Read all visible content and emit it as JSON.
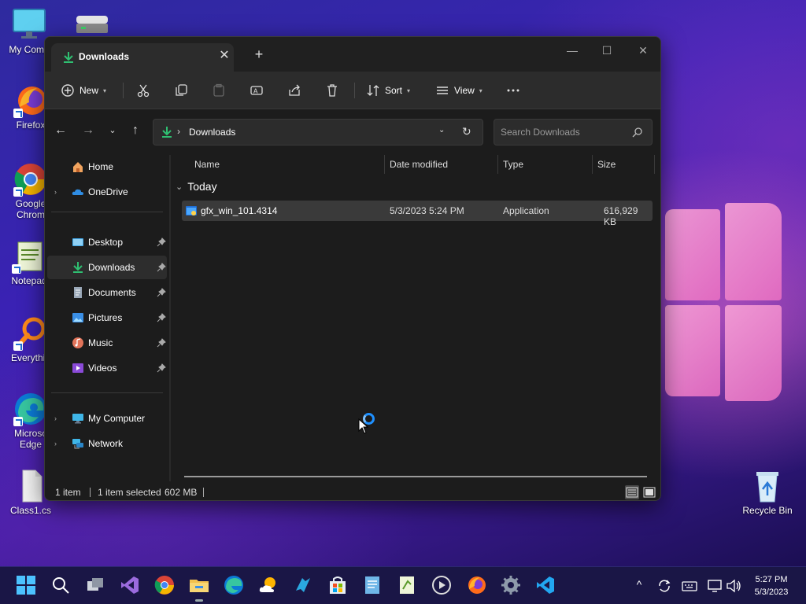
{
  "desktop": {
    "icons": [
      {
        "label": "My Comp",
        "icon": "monitor-icon"
      },
      {
        "label": "",
        "icon": "drive-icon"
      },
      {
        "label": "Firefox",
        "icon": "firefox-icon"
      },
      {
        "label": "Google",
        "label2": "Chrom",
        "icon": "chrome-icon"
      },
      {
        "label": "Notepad",
        "icon": "notepad-icon"
      },
      {
        "label": "Everythin",
        "icon": "search-tool-icon"
      },
      {
        "label": "Microso",
        "label2": "Edge",
        "icon": "edge-icon"
      },
      {
        "label": "Class1.cs",
        "icon": "file-icon"
      },
      {
        "label": "Recycle Bin",
        "icon": "recycle-bin-icon"
      }
    ]
  },
  "window": {
    "tab_title": "Downloads",
    "toolbar": {
      "new_label": "New",
      "sort_label": "Sort",
      "view_label": "View"
    },
    "address": {
      "path": "Downloads"
    },
    "search": {
      "placeholder": "Search Downloads"
    },
    "sidebar": {
      "items": [
        {
          "label": "Home",
          "icon": "home-icon"
        },
        {
          "label": "OneDrive",
          "icon": "cloud-icon"
        },
        {
          "label": "Desktop",
          "icon": "desktop-folder-icon"
        },
        {
          "label": "Downloads",
          "icon": "download-icon"
        },
        {
          "label": "Documents",
          "icon": "document-icon"
        },
        {
          "label": "Pictures",
          "icon": "pictures-icon"
        },
        {
          "label": "Music",
          "icon": "music-icon"
        },
        {
          "label": "Videos",
          "icon": "video-icon"
        },
        {
          "label": "My Computer",
          "icon": "computer-icon"
        },
        {
          "label": "Network",
          "icon": "network-icon"
        }
      ]
    },
    "columns": {
      "name": "Name",
      "date": "Date modified",
      "type": "Type",
      "size": "Size"
    },
    "group_label": "Today",
    "files": [
      {
        "name": "gfx_win_101.4314",
        "date": "5/3/2023 5:24 PM",
        "type": "Application",
        "size": "616,929 KB"
      }
    ],
    "status": {
      "count": "1 item",
      "selected": "1 item selected",
      "size": "602 MB"
    }
  },
  "taskbar": {
    "time": "5:27 PM",
    "date": "5/3/2023"
  },
  "colors": {
    "accent": "#1e90ff",
    "download_green": "#2fbf71",
    "folder_yellow": "#f2c14e"
  }
}
